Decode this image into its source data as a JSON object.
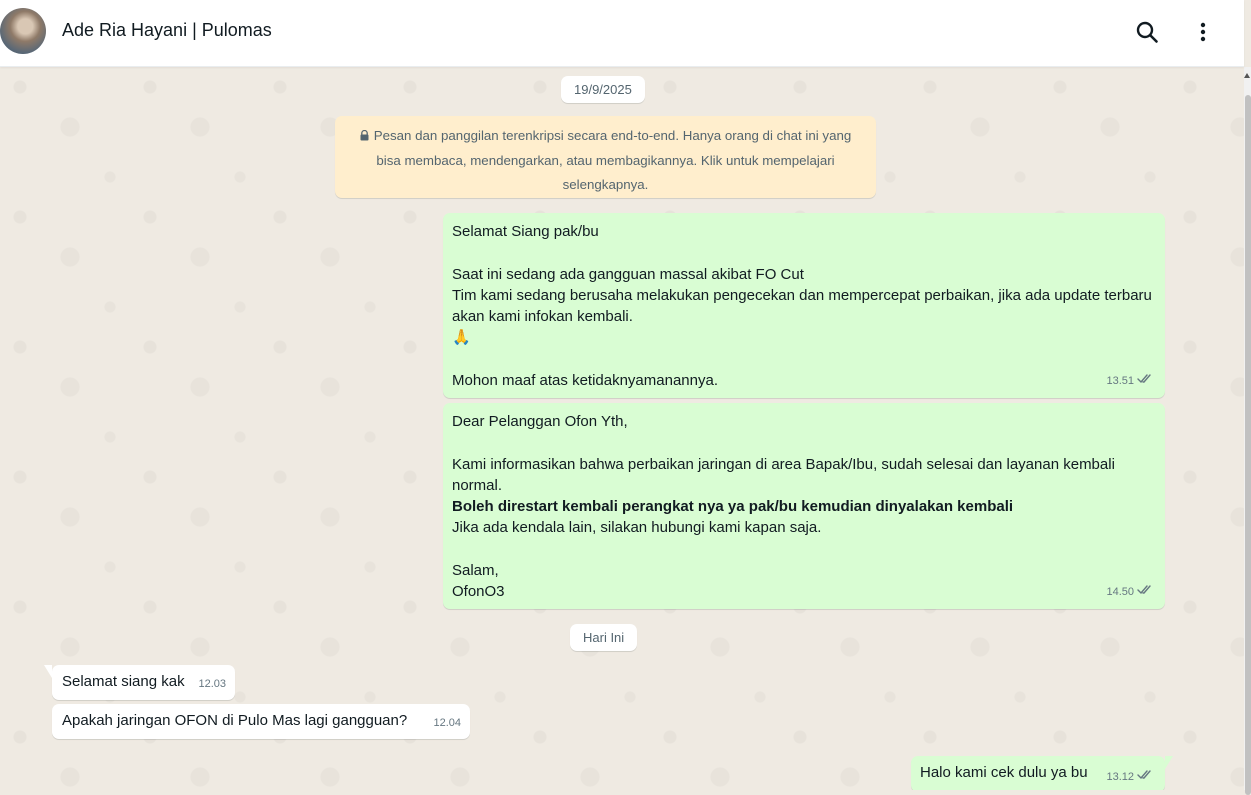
{
  "header": {
    "contact_name": "Ade Ria Hayani | Pulomas"
  },
  "chat": {
    "date_dividers": [
      "19/9/2025",
      "Hari Ini"
    ],
    "encryption_notice": "Pesan dan panggilan terenkripsi secara end-to-end. Hanya orang di chat ini yang bisa membaca, mendengarkan, atau membagikannya. Klik untuk mempelajari selengkapnya.",
    "messages": [
      {
        "direction": "outgoing",
        "text": "Selamat Siang pak/bu\n\nSaat ini sedang ada gangguan massal akibat FO Cut\nTim kami sedang berusaha melakukan pengecekan dan mempercepat perbaikan, jika ada update terbaru akan kami infokan kembali.\n🙏\n\nMohon maaf atas ketidaknyamanannya.",
        "time": "13.51",
        "status": "read"
      },
      {
        "direction": "outgoing",
        "text_before": "Dear Pelanggan Ofon Yth,\n\nKami informasikan bahwa perbaikan jaringan di area Bapak/Ibu, sudah selesai dan layanan kembali normal.",
        "text_bold": "Boleh direstart kembali perangkat nya ya pak/bu kemudian dinyalakan kembali",
        "text_after": "Jika ada kendala lain, silakan hubungi kami kapan saja.\n\nSalam,\nOfonO3",
        "time": "14.50",
        "status": "read"
      },
      {
        "direction": "incoming",
        "text": "Selamat siang kak",
        "time": "12.03"
      },
      {
        "direction": "incoming",
        "text": "Apakah jaringan OFON di Pulo Mas lagi gangguan?",
        "time": "12.04"
      },
      {
        "direction": "outgoing",
        "text": "Halo kami cek dulu ya bu",
        "time": "13.12",
        "status": "read"
      }
    ]
  },
  "icons": {
    "header_actions": [
      "search-icon",
      "kebab-menu-icon"
    ],
    "notice": "lock-icon",
    "message_status": "double-check-icon"
  },
  "colors": {
    "chat_background": "#efeae2",
    "outgoing_bubble": "#d9fdd3",
    "incoming_bubble": "#ffffff",
    "encryption_notice": "#ffeecd",
    "read_ticks": "#667781"
  }
}
